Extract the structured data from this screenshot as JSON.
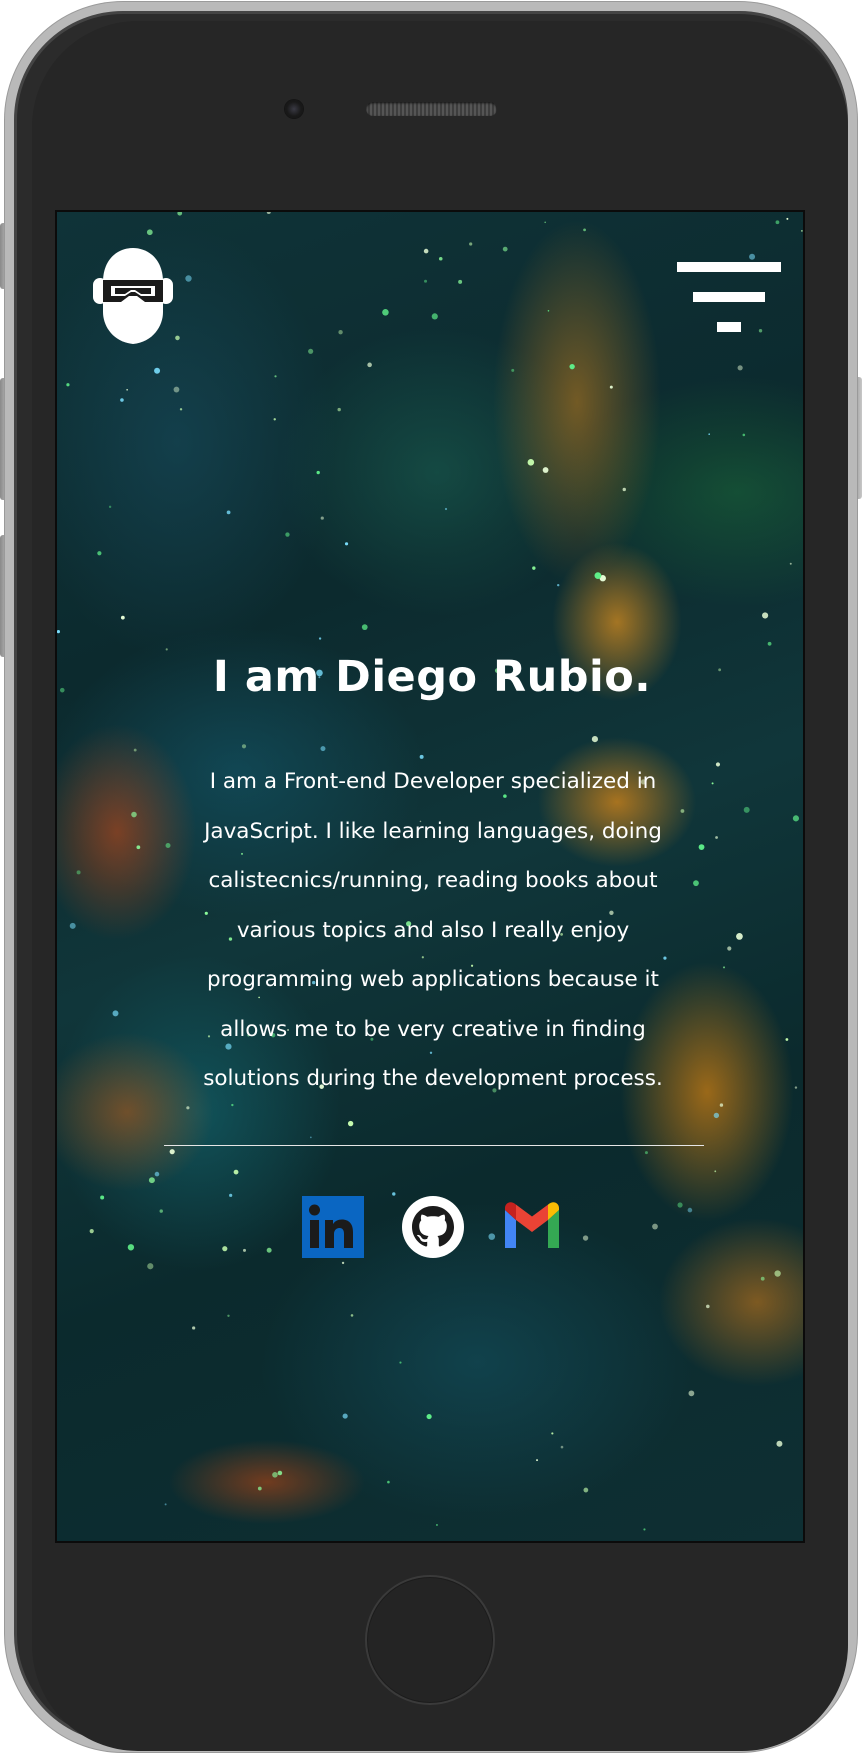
{
  "hero": {
    "title": "I am Diego Rubio.",
    "description": "I am a Front-end Developer specialized in JavaScript. I like learning languages, doing calistecnics/running, reading books about various topics and also I really enjoy programming web applications because it allows me to be very creative in finding solutions during the development process."
  },
  "icons": {
    "logo": "helmet-logo-icon",
    "menu": "menu-icon",
    "linkedin": "linkedin-icon",
    "github": "github-icon",
    "gmail": "gmail-icon"
  },
  "colors": {
    "text": "#ffffff",
    "linkedin": "#0a66c2",
    "gmail_blue": "#4285f4",
    "gmail_green": "#34a853",
    "gmail_yellow": "#fbbc04",
    "gmail_red": "#ea4335",
    "phone_body": "#2b2b2b",
    "phone_edge": "#b9b9b9"
  }
}
